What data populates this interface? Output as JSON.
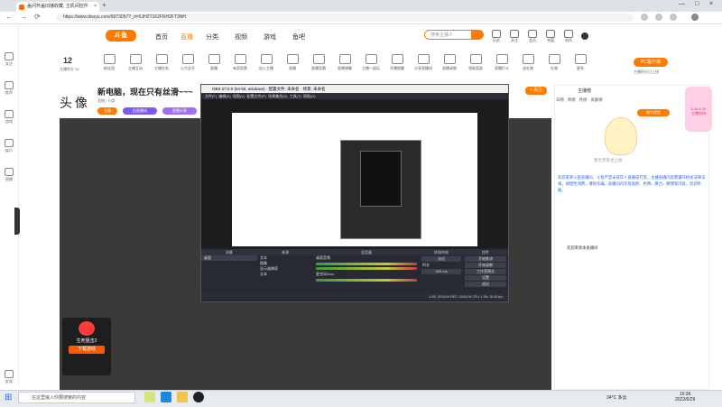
{
  "browser": {
    "tab_title": "盖问怀盖旧播收藏, 主机间控件",
    "tab_close": "×",
    "new_tab": "+",
    "url": "https://www.douyu.com/9973057?_rt=5JH2T162FNH2FT3NH",
    "nav_back": "←",
    "nav_forward": "→",
    "nav_reload": "⟳",
    "win_minimize": "—",
    "win_maximize": "□",
    "win_close": "×"
  },
  "site": {
    "logo": "斗鱼",
    "nav": [
      "首页",
      "直播",
      "分类",
      "视频",
      "游戏",
      "鱼吧"
    ],
    "search_placeholder": "搜索主播人",
    "header_icons": [
      "历史",
      "关注",
      "会员",
      "充值",
      "创作"
    ]
  },
  "sidebar": {
    "items": [
      "关注",
      "推荐",
      "游戏",
      "娱乐",
      "直播",
      "发现"
    ]
  },
  "toolbar": {
    "level": "12",
    "level_label": "主播积分 10",
    "items": [
      "直播预告",
      "粉丝团",
      "主播互动",
      "主播任务",
      "火力全开",
      "直播",
      "有奖投票",
      "加入主播",
      "直播",
      "直播竞猜",
      "直播弹幕",
      "主播一起玩",
      "开播提醒",
      "分享直播间",
      "直播录制",
      "领取奖励",
      "直播打卡",
      "送礼物",
      "礼物",
      "更多"
    ],
    "pc_button": "PC客户端",
    "pc_link": "主播积分已上线"
  },
  "room": {
    "avatar_title": "头像",
    "title": "新电脑，现在只有丝滑~~~",
    "meta": "直播 | 分类",
    "tags": [
      "主播",
      "旧直播间",
      "直播分享"
    ],
    "follow": "+ 关注"
  },
  "obs": {
    "title": "OBS 27.0.0 (64-bit, windows) · 配置文件: 未命名 · 场景: 未命名",
    "menu": [
      "文件(F)",
      "编辑(E)",
      "视图(V)",
      "配置文件(P)",
      "场景集合(S)",
      "工具(T)",
      "帮助(H)"
    ],
    "panels": {
      "scenes_header": "场景",
      "scenes": [
        "桌面"
      ],
      "sources_header": "来源",
      "sources": [
        "文本",
        "图像",
        "显示器捕获",
        "文本"
      ],
      "mixer_header": "混音器",
      "mixer": [
        "桌面音频",
        "麦克风/Aux"
      ],
      "transitions_header": "转场特效",
      "transition_value": "淡出",
      "duration_label": "时长",
      "duration_value": "300 ms",
      "controls_header": "控件",
      "controls": [
        "开始推流",
        "开始录制",
        "工作室模式",
        "设置",
        "退出"
      ]
    },
    "status": "LIVE: 00:00:00    REC: 00:00:00    CPU: 1.5%, 30.00 fps"
  },
  "right_panel": {
    "tab_rank": "主播榜",
    "rank_tabs": [
      "日榜",
      "周榜",
      "月榜"
    ],
    "rank_sub": "贡献榜",
    "rank_button": "成为榜首",
    "empty_text": "暂无贵宾坐上榜",
    "notice": "欢迎来到斗鱼直播间，斗鱼严禁未成年人直播或打赏。主播直播内容需遵守相关法律法规，请理性消费，谨防诈骗。直播间内涉及低俗、色情、暴力、赌博等内容，欢迎举报。",
    "gift_link": "欢迎来到本直播间",
    "promo_date": "6.28-6.30",
    "promo_label": "主播扶持"
  },
  "card": {
    "title": "生死狙击2",
    "button": "下载游戏"
  },
  "taskbar": {
    "start": "⊞",
    "search": "在这里输入你要搜索的内容",
    "weather": "34°C 多云",
    "time": "15:36",
    "date": "2022/6/29"
  }
}
